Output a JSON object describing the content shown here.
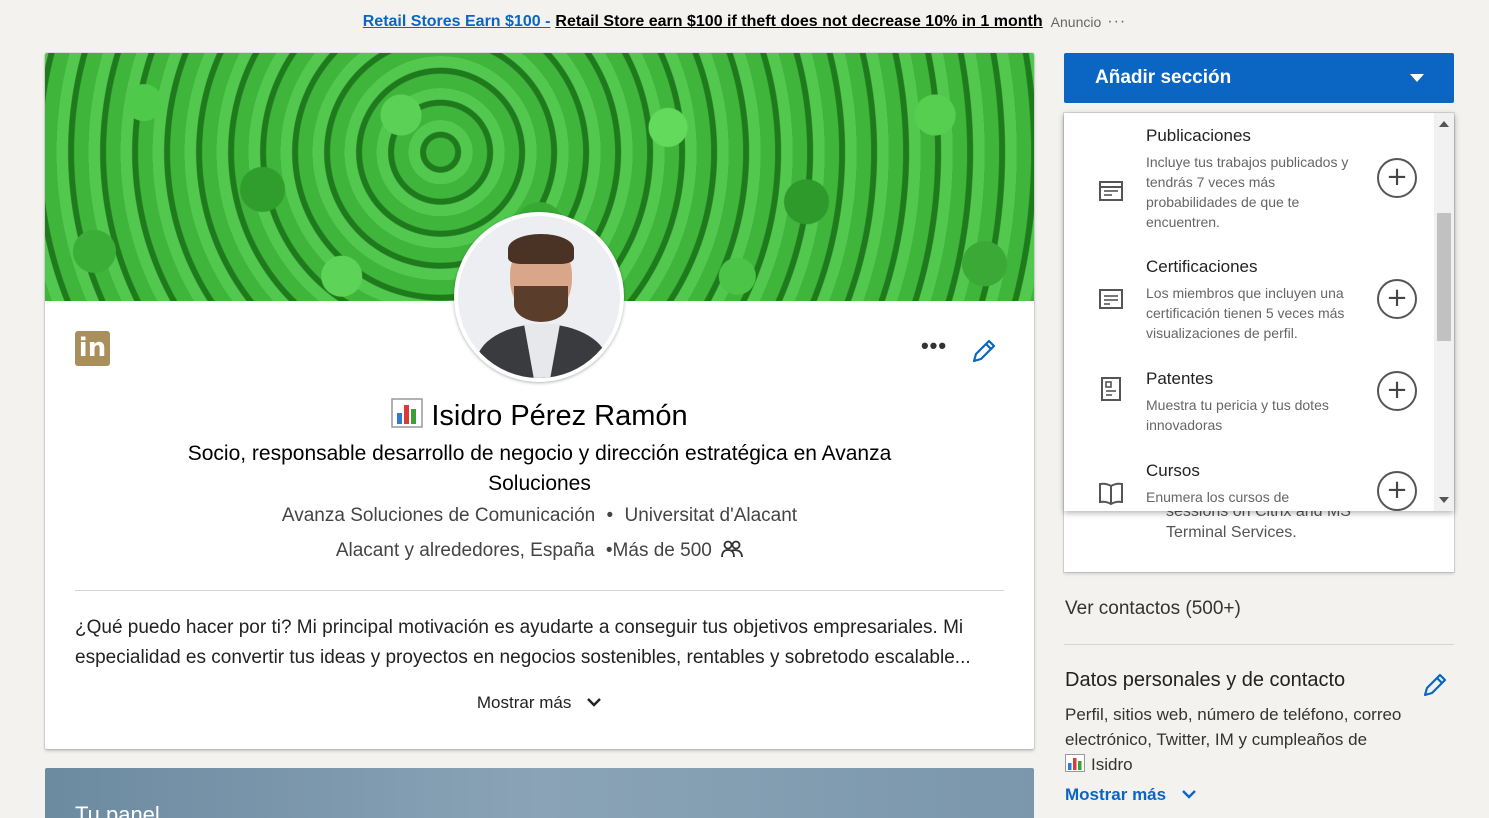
{
  "ad": {
    "link_text": "Retail Stores Earn $100 -",
    "text": "Retail Store earn $100 if theft does not decrease 10% in 1 month",
    "label": "Anuncio",
    "more": "···"
  },
  "profile": {
    "logo_text": "in",
    "more": "•••",
    "name": "Isidro Pérez Ramón",
    "headline": "Socio, responsable desarrollo de negocio y dirección estratégica en Avanza Soluciones",
    "company": "Avanza Soluciones de Comunicación",
    "separator": "•",
    "school": "Universitat d'Alacant",
    "location": "Alacant y alrededores, España",
    "connections": "•Más de 500",
    "summary": "¿Qué puedo hacer por ti? Mi principal motivación es ayudarte a conseguir tus objetivos empresariales. Mi especialidad es convertir tus ideas y proyectos en negocios sostenibles, rentables y sobretodo escalable...",
    "show_more": "Mostrar más"
  },
  "dashboard": {
    "title": "Tu panel"
  },
  "sidebar": {
    "add_section_label": "Añadir sección",
    "underlying_text": "sessions on Citrix and MS Terminal Services.",
    "dropdown_items": [
      {
        "icon": "publications-icon",
        "title": "Publicaciones",
        "desc": "Incluye tus trabajos publicados y tendrás 7 veces más probabilidades de que te encuentren.",
        "add": "+"
      },
      {
        "icon": "certificate-icon",
        "title": "Certificaciones",
        "desc": "Los miembros que incluyen una certificación tienen 5 veces más visualizaciones de perfil.",
        "add": "+"
      },
      {
        "icon": "patent-icon",
        "title": "Patentes",
        "desc": "Muestra tu pericia y tus dotes innovadoras",
        "add": "+"
      },
      {
        "icon": "book-icon",
        "title": "Cursos",
        "desc": "Enumera los cursos de",
        "add": "+"
      }
    ],
    "view_contacts": "Ver contactos (500+)",
    "personal_data_title": "Datos personales y de contacto",
    "personal_data_desc": "Perfil, sitios web, número de teléfono, correo electrónico, Twitter, IM y cumpleaños de",
    "personal_data_name": "Isidro",
    "personal_data_more": "Mostrar más"
  },
  "colors": {
    "accent": "#0a66c2",
    "background": "#f3f2ef",
    "logo": "#a88f5c"
  }
}
